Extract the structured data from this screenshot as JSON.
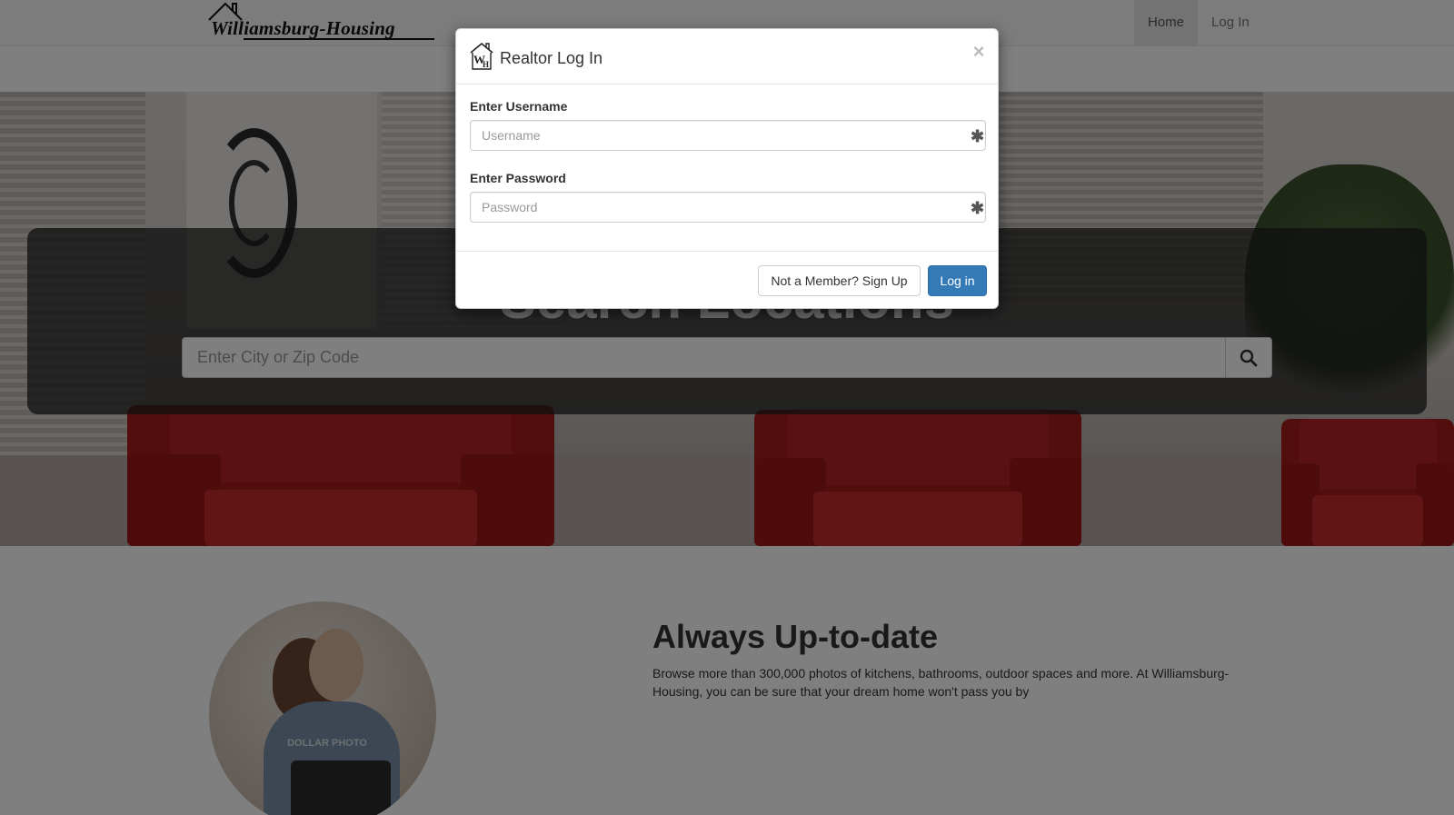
{
  "navbar": {
    "brand": "Williamsburg-Housing",
    "links": [
      {
        "label": "Home",
        "active": true
      },
      {
        "label": "Log In",
        "active": false
      }
    ]
  },
  "hero": {
    "title": "Search Locations",
    "search_placeholder": "Enter City or Zip Code",
    "search_icon": "magnifier-icon"
  },
  "feature": {
    "heading": "Always Up-to-date",
    "text": "Browse more than 300,000 photos of kitchens, bathrooms, outdoor spaces and more. At Williamsburg-Housing, you can be sure that your dream home won't pass you by"
  },
  "modal": {
    "title": "Realtor Log In",
    "close_label": "×",
    "username_label": "Enter Username",
    "username_placeholder": "Username",
    "password_label": "Enter Password",
    "password_placeholder": "Password",
    "required_icon": "asterisk-icon",
    "signup_label": "Not a Member? Sign Up",
    "login_label": "Log in"
  },
  "colors": {
    "primary": "#337ab7",
    "backdrop": "rgba(0,0,0,0.5)"
  }
}
